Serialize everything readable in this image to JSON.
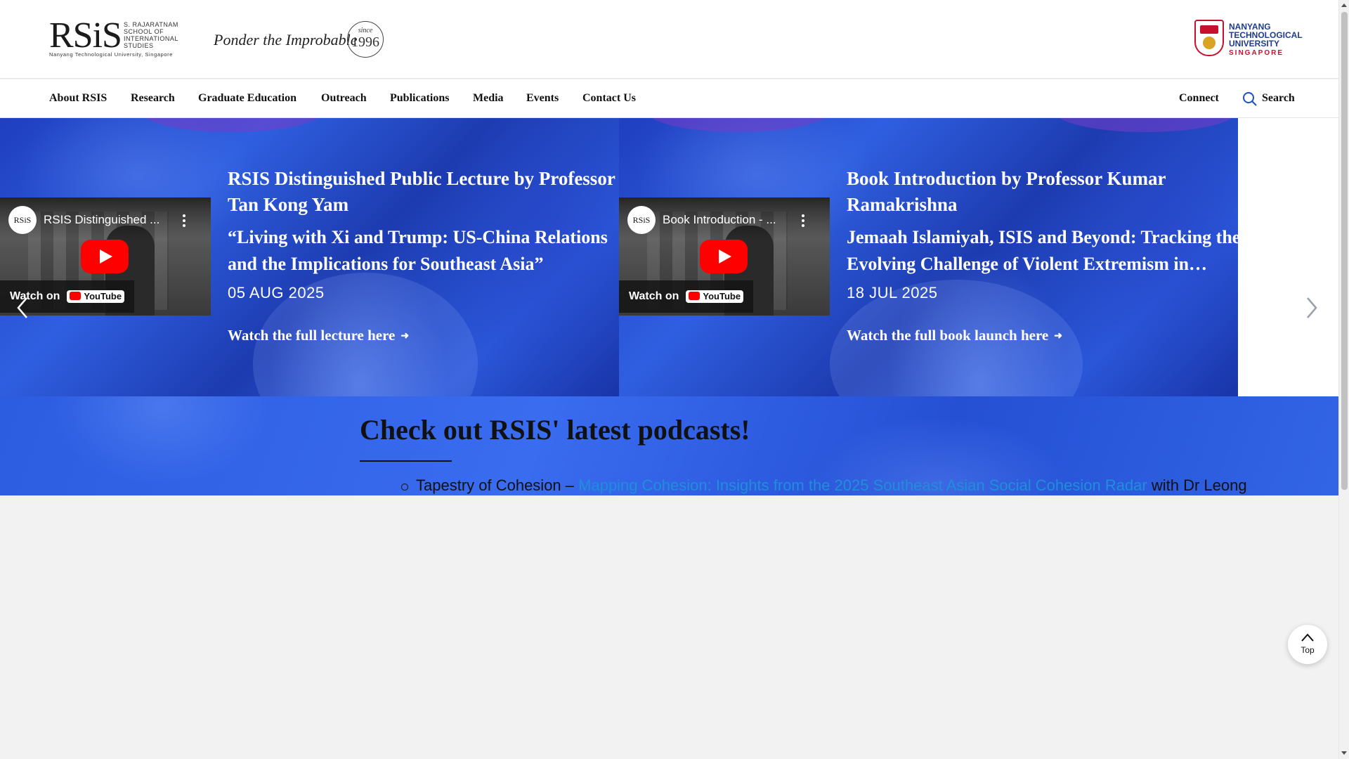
{
  "header": {
    "logo_mark": "RSiS",
    "logo_small": "S. RAJARATNAM SCHOOL OF INTERNATIONAL STUDIES",
    "logo_tag": "Nanyang Technological University, Singapore",
    "slogan": "Ponder the Improbable",
    "since": "since",
    "year": "1996",
    "ntu_name": "NANYANG TECHNOLOGICAL UNIVERSITY",
    "ntu_country": "SINGAPORE"
  },
  "nav": {
    "items": [
      "About RSIS",
      "Research",
      "Graduate Education",
      "Outreach",
      "Publications",
      "Media",
      "Events",
      "Contact Us"
    ],
    "connect": "Connect",
    "search": "Search"
  },
  "slides": [
    {
      "video_channel": "RSiS",
      "video_title": "RSIS Distinguished ...",
      "watch_on": "Watch on",
      "youtube": "YouTube",
      "title": "RSIS Distinguished Public Lecture by Professor Tan Kong Yam",
      "subtitle": "“Living with Xi and Trump: US-China Relations and the Implications for Southeast Asia”",
      "date": "05 AUG 2025",
      "link": "Watch the full lecture here"
    },
    {
      "video_channel": "RSiS",
      "video_title": "Book Introduction - ...",
      "watch_on": "Watch on",
      "youtube": "YouTube",
      "title": "Book Introduction by Professor Kumar Ramakrishna",
      "subtitle": "Jemaah Islamiyah, ISIS and Beyond: Tracking the Evolving Challenge of Violent Extremism in…",
      "date": "18 JUL 2025",
      "link": "Watch the full book launch here"
    }
  ],
  "podcast": {
    "heading": "Check out RSIS' latest podcasts!",
    "item_prefix": "Tapestry of Cohesion – ",
    "item_link": "Mapping Cohesion: Insights from the 2025 Southeast Asian Social Cohesion Radar",
    "item_suffix": " with Dr Leong"
  },
  "top_button": "Top",
  "colors": {
    "hero_blue": "#2a56d8",
    "link_blue": "#1e8fd8",
    "ntu_blue": "#1d3c8f",
    "brand_red": "#c8102e"
  }
}
